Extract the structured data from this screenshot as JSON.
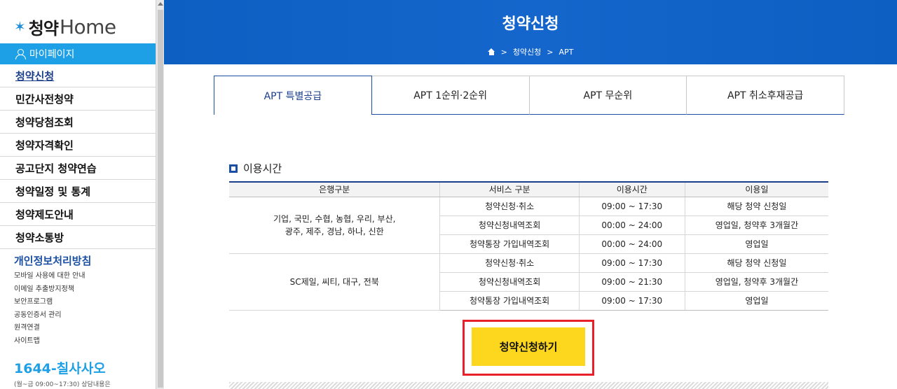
{
  "sidebar": {
    "logo": {
      "ko": "청약",
      "en": "Home"
    },
    "mypage_label": "마이페이지",
    "menu": [
      "청약신청",
      "민간사전청약",
      "청약당첨조회",
      "청약자격확인",
      "공고단지 청약연습",
      "청약일정 및 통계",
      "청약제도안내",
      "청약소통방"
    ],
    "policy_title": "개인정보처리방침",
    "sub_links": [
      "모바일 사용에 대한 안내",
      "이메일 추출방지정책",
      "보안프로그램",
      "공동인증서 관리",
      "원격연결",
      "사이트맵"
    ],
    "phone": "1644-칠사사오",
    "hours": "(월~금 09:00~17:30) 상담내용은"
  },
  "header": {
    "title": "청약신청",
    "breadcrumb": [
      "청약신청",
      "APT"
    ]
  },
  "tabs": [
    "APT 특별공급",
    "APT 1순위·2순위",
    "APT 무순위",
    "APT 취소후재공급"
  ],
  "section": {
    "title": "이용시간",
    "columns": [
      "은행구분",
      "서비스 구분",
      "이용시간",
      "이용일"
    ],
    "groups": [
      {
        "bank_lines": [
          "기업, 국민, 수협, 농협, 우리, 부산,",
          "광주, 제주, 경남, 하나, 신한"
        ],
        "rows": [
          [
            "청약신청·취소",
            "09:00 ~ 17:30",
            "해당 청약 신청일"
          ],
          [
            "청약신청내역조회",
            "00:00 ~ 24:00",
            "영업일, 청약후 3개월간"
          ],
          [
            "청약통장 가입내역조회",
            "00:00 ~ 24:00",
            "영업일"
          ]
        ]
      },
      {
        "bank_lines": [
          "SC제일, 씨티, 대구, 전북"
        ],
        "rows": [
          [
            "청약신청·취소",
            "09:00 ~ 17:30",
            "해당 청약 신청일"
          ],
          [
            "청약신청내역조회",
            "09:00 ~ 21:30",
            "영업일, 청약후 3개월간"
          ],
          [
            "청약통장 가입내역조회",
            "09:00 ~ 17:30",
            "영업일"
          ]
        ]
      }
    ]
  },
  "apply_button": "청약신청하기"
}
